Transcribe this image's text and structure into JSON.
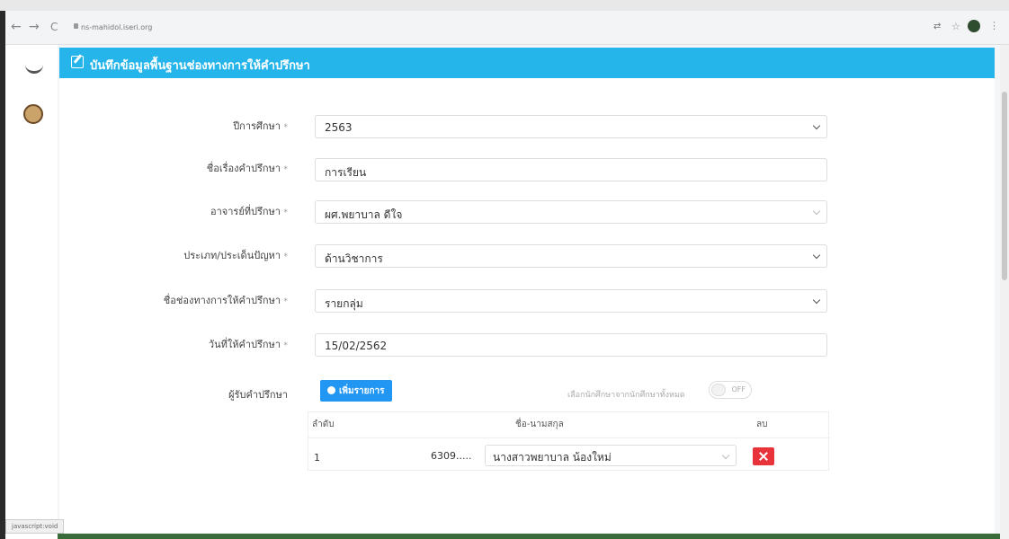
{
  "browser": {
    "url": "ns-mahidol.iseri.org"
  },
  "page": {
    "title": "บันทึกข้อมูลพื้นฐานช่องทางการให้คำปรึกษา"
  },
  "form": {
    "academic_year": {
      "label": "ปีการศึกษา",
      "value": "2563"
    },
    "topic": {
      "label": "ชื่อเรื่องคำปรึกษา",
      "value": "การเรียน"
    },
    "advisor": {
      "label": "อาจารย์ที่ปรึกษา",
      "value": "ผศ.พยาบาล ดีใจ"
    },
    "problem_type": {
      "label": "ประเภท/ประเด็นปัญหา",
      "value": "ด้านวิชาการ"
    },
    "channel": {
      "label": "ชื่อช่องทางการให้คำปรึกษา",
      "value": "รายกลุ่ม"
    },
    "date": {
      "label": "วันที่ให้คำปรึกษา",
      "value": "15/02/2562"
    },
    "required_mark": "*",
    "consultees": {
      "label": "ผู้รับคำปรึกษา",
      "add_button": "เพิ่มรายการ",
      "toggle_label": "เลือกนักศึกษาจากนักศึกษาทั้งหมด",
      "toggle_state": "OFF",
      "columns": {
        "no": "ลำดับ",
        "name": "ชื่อ-นามสกุล",
        "delete": "ลบ"
      },
      "rows": [
        {
          "no": "1",
          "id": "6309.....",
          "name": "นางสาวพยาบาล น้องใหม่"
        }
      ]
    }
  },
  "statusbar": {
    "text": "javascript:void"
  },
  "colors": {
    "header": "#26b5ea",
    "add_button": "#2196f3",
    "delete": "#e8333b"
  }
}
